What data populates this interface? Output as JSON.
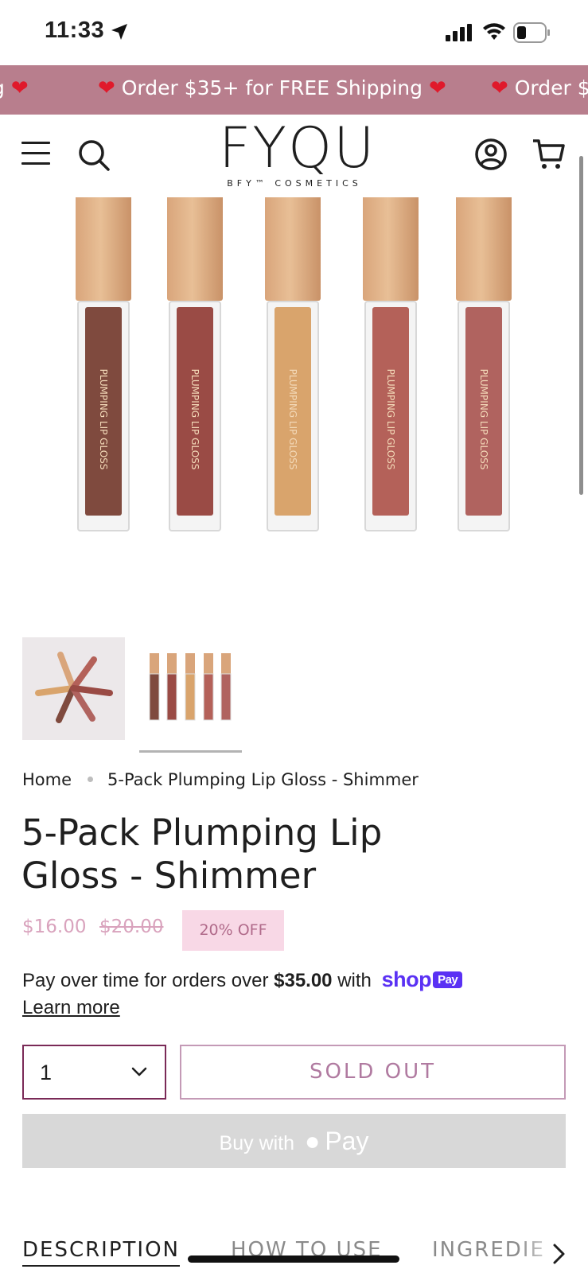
{
  "status_bar": {
    "time": "11:33",
    "icons": [
      "location-arrow-icon",
      "cellular-signal-icon",
      "wifi-icon",
      "battery-icon"
    ]
  },
  "announcement": {
    "text": "Order $35+ for FREE Shipping",
    "background": "#b87e8d",
    "heart_color": "#e0192b",
    "partial_left": "g",
    "partial_right": "Order $"
  },
  "header": {
    "logo_main": "FYQU",
    "logo_sub": "BFY™ COSMETICS",
    "icons": [
      "menu-icon",
      "search-icon",
      "account-icon",
      "cart-icon"
    ]
  },
  "gallery": {
    "label_text": "PLUMPING LIP GLOSS",
    "shades": [
      "#7f4a3e",
      "#9a4b45",
      "#d9a46c",
      "#b46159",
      "#b0635f"
    ],
    "thumbnails": [
      "lifestyle-scatter",
      "five-tubes"
    ],
    "selected_thumbnail": 1
  },
  "breadcrumb": {
    "home": "Home",
    "current": "5-Pack Plumping Lip Gloss - Shimmer"
  },
  "product": {
    "title_line1": "5-Pack Plumping Lip",
    "title_line2": "Gloss - Shimmer",
    "price": "$16.00",
    "compare_price": "$20.00",
    "discount_badge": "20% OFF"
  },
  "installments": {
    "text_before": "Pay over time for orders over ",
    "amount": "$35.00",
    "text_after": " with",
    "brand": "shop",
    "chip": "Pay",
    "learn_more": "Learn more"
  },
  "purchase": {
    "quantity": "1",
    "sold_out_label": "SOLD OUT",
    "apple_pay_prefix": "Buy with",
    "apple_pay_suffix": "Pay",
    "accent": "#7a2a57"
  },
  "tabs": {
    "items": [
      "DESCRIPTION",
      "HOW TO USE",
      "INGREDIE"
    ],
    "active": 0
  }
}
